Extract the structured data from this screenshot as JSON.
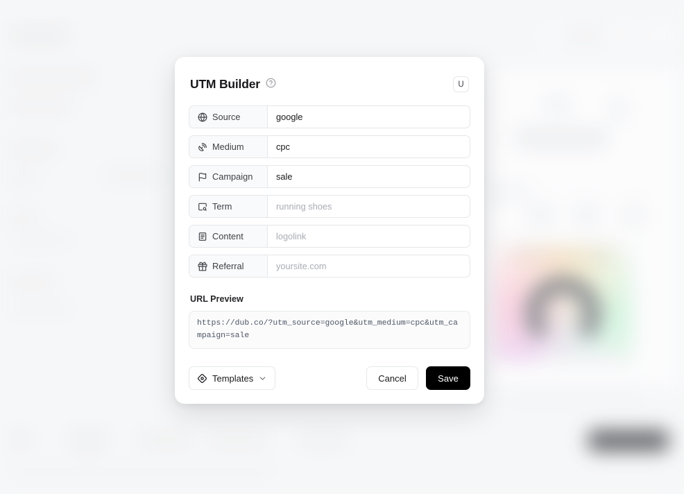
{
  "modal": {
    "title": "UTM Builder",
    "help_icon": "question-circle-icon",
    "shortcut_badge": "U",
    "fields": [
      {
        "icon": "globe-icon",
        "label": "Source",
        "value": "google",
        "placeholder": "google"
      },
      {
        "icon": "satellite-dish-icon",
        "label": "Medium",
        "value": "cpc",
        "placeholder": "cpc"
      },
      {
        "icon": "flag-icon",
        "label": "Campaign",
        "value": "sale",
        "placeholder": "sale"
      },
      {
        "icon": "search-box-icon",
        "label": "Term",
        "value": "",
        "placeholder": "running shoes"
      },
      {
        "icon": "document-icon",
        "label": "Content",
        "value": "",
        "placeholder": "logolink"
      },
      {
        "icon": "gift-icon",
        "label": "Referral",
        "value": "",
        "placeholder": "yoursite.com"
      }
    ],
    "preview": {
      "heading": "URL Preview",
      "url": "https://dub.co/?utm_source=google&utm_medium=cpc&utm_campaign=sale"
    },
    "footer": {
      "templates_label": "Templates",
      "templates_icon": "gem-icon",
      "chevron_icon": "chevron-down-icon",
      "cancel_label": "Cancel",
      "save_label": "Save"
    }
  },
  "colors": {
    "save_bg": "#000000",
    "page_bg": "#f7f8f9",
    "border": "#e6e7ea",
    "label_bg": "#f9fafb"
  }
}
